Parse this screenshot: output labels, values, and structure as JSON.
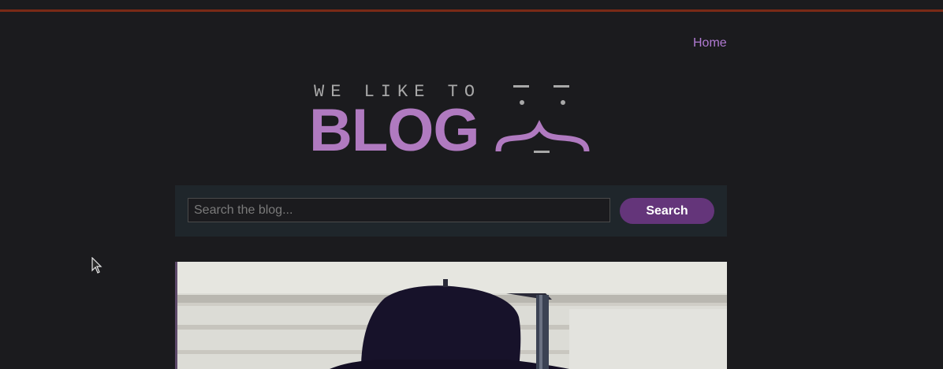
{
  "nav": {
    "home_label": "Home"
  },
  "logo": {
    "tagline": "WE LIKE TO",
    "word": "BLOG"
  },
  "search": {
    "placeholder": "Search the blog...",
    "value": "",
    "button_label": "Search"
  },
  "colors": {
    "background": "#1b1b1e",
    "top_rule": "#7a2a17",
    "accent": "#b07ad2",
    "button": "#64357a",
    "search_panel": "#1f262b"
  },
  "icons": {
    "logo_face": "face-icon",
    "cursor": "mouse-pointer-icon"
  }
}
